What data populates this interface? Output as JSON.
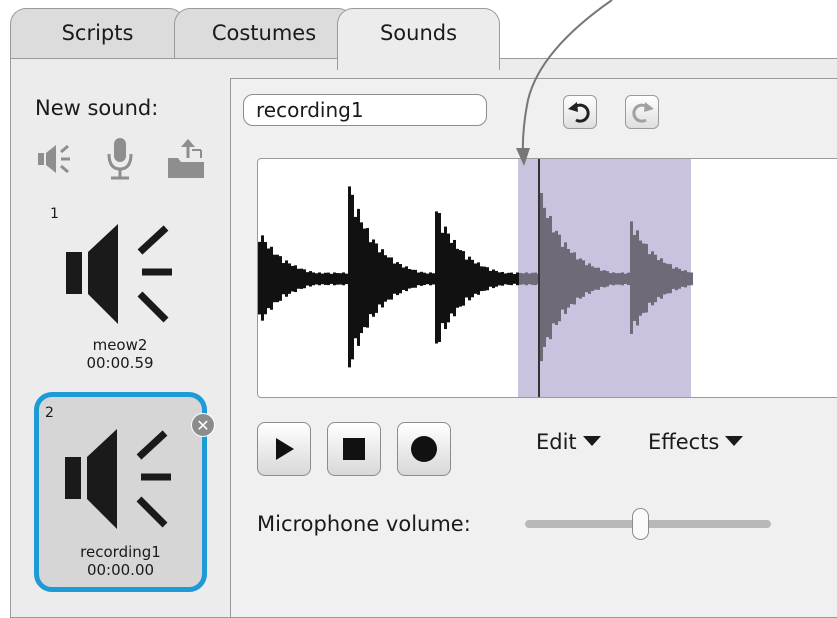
{
  "tabs": [
    {
      "label": "Scripts",
      "active": false
    },
    {
      "label": "Costumes",
      "active": false
    },
    {
      "label": "Sounds",
      "active": true
    }
  ],
  "new_sound": {
    "label": "New sound:",
    "icons": [
      "speaker-library-icon",
      "microphone-icon",
      "upload-folder-icon"
    ]
  },
  "sounds": [
    {
      "number": "1",
      "name": "meow2",
      "duration": "00:00.59",
      "selected": false
    },
    {
      "number": "2",
      "name": "recording1",
      "duration": "00:00.00",
      "selected": true
    }
  ],
  "editor": {
    "sound_name": "recording1",
    "undo_icon": "undo-icon",
    "redo_icon": "redo-icon",
    "selection_color": "#c9c3e0",
    "controls": [
      "play-icon",
      "stop-icon",
      "record-icon"
    ],
    "menus": [
      "Edit",
      "Effects"
    ],
    "mic_label": "Microphone volume:",
    "mic_volume_fraction": 0.47
  },
  "colors": {
    "accent": "#1e9ad6",
    "panel": "#ececec"
  }
}
